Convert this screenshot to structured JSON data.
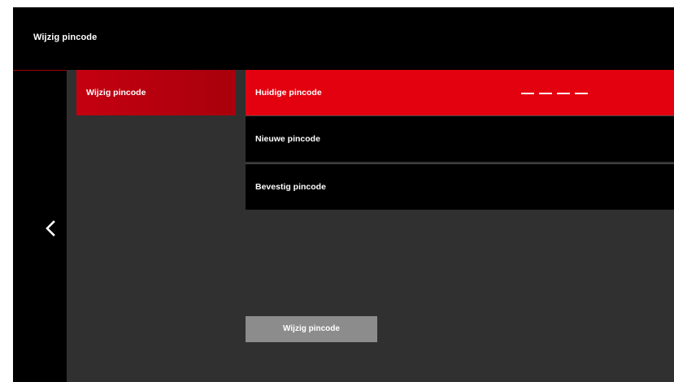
{
  "header": {
    "title": "Wijzig pincode"
  },
  "sidebar": {
    "items": [
      {
        "label": "Wijzig pincode",
        "selected": true
      }
    ]
  },
  "form": {
    "fields": [
      {
        "label": "Huidige pincode",
        "value": "– – – –",
        "active": true
      },
      {
        "label": "Nieuwe pincode",
        "value": "",
        "active": false
      },
      {
        "label": "Bevestig pincode",
        "value": "",
        "active": false
      }
    ],
    "submit_label": "Wijzig pincode"
  },
  "icons": {
    "back": "chevron-left-icon"
  },
  "colors": {
    "accent": "#e3000f",
    "menu_selected": "#c40010",
    "background": "#303030",
    "header": "#000000",
    "button_disabled": "#8c8c8c"
  }
}
